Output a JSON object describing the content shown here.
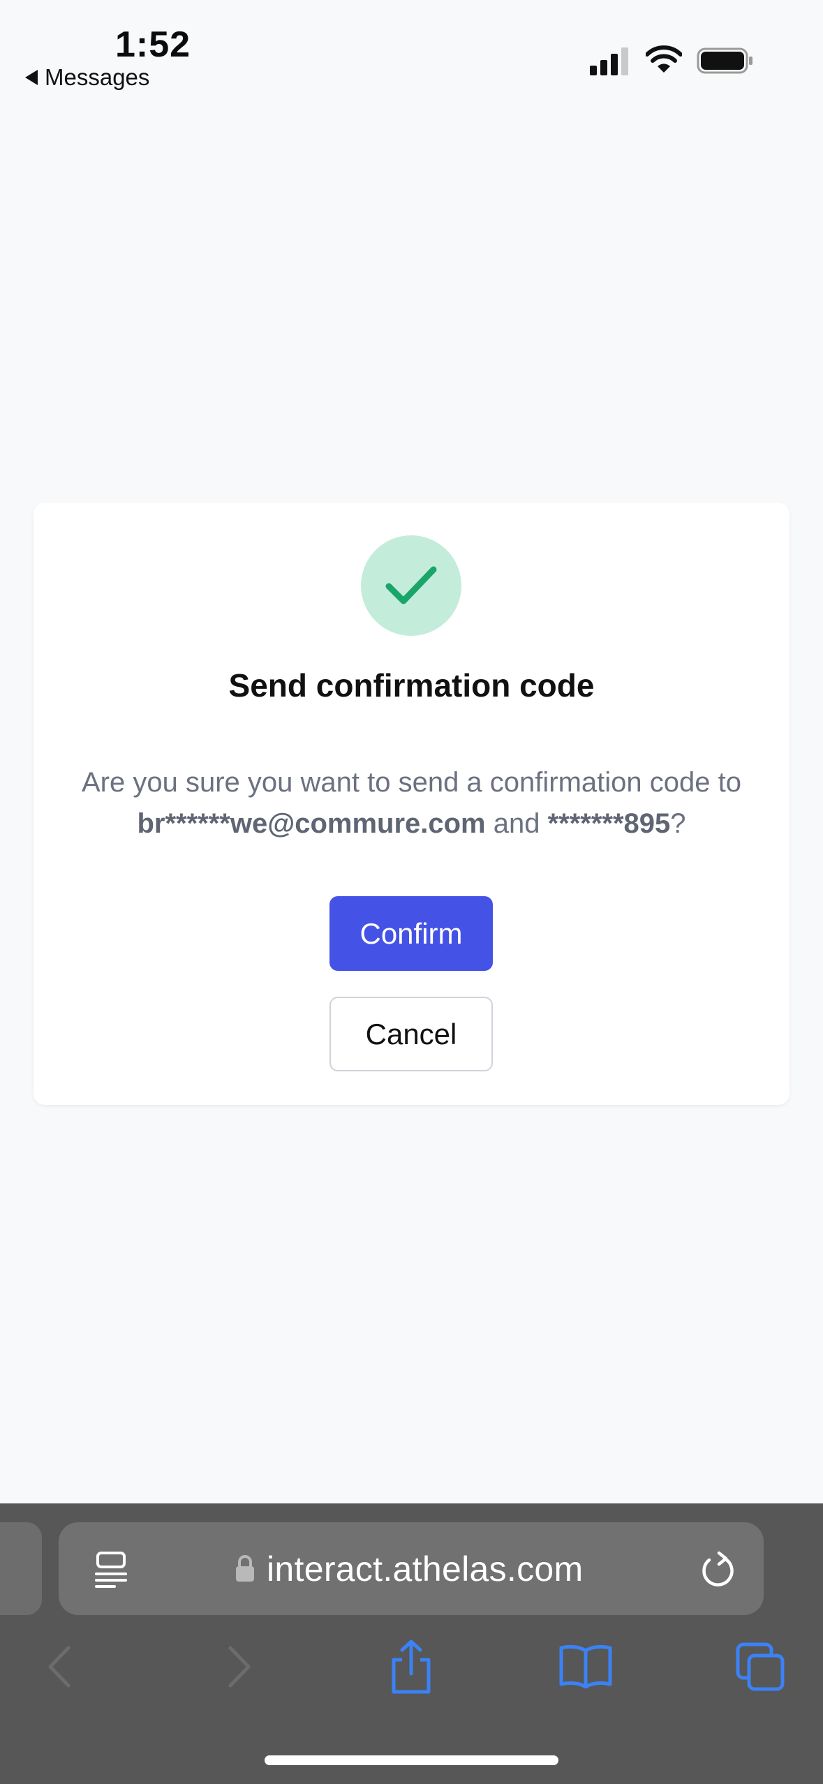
{
  "status_bar": {
    "time": "1:52",
    "back_label": "Messages",
    "icons": [
      "cellular-signal-icon",
      "wifi-icon",
      "battery-icon"
    ]
  },
  "dialog": {
    "icon": "checkmark-icon",
    "title": "Send confirmation code",
    "message_prefix": "Are you sure you want to send a confirmation code to ",
    "email": "br******we@commure.com",
    "message_middle": " and ",
    "phone": "*******895",
    "message_suffix": "?",
    "confirm_label": "Confirm",
    "cancel_label": "Cancel"
  },
  "browser": {
    "url": "interact.athelas.com",
    "toolbar_icons": [
      "back-icon",
      "forward-icon",
      "share-icon",
      "bookmarks-icon",
      "tabs-icon"
    ]
  },
  "colors": {
    "accent": "#4552e6",
    "success_bg": "#c3ecdb",
    "success_check": "#1aa56a",
    "toolbar_blue": "#3b82f6",
    "page_bg": "#f8f9fb",
    "safari_bar": "#575757"
  }
}
